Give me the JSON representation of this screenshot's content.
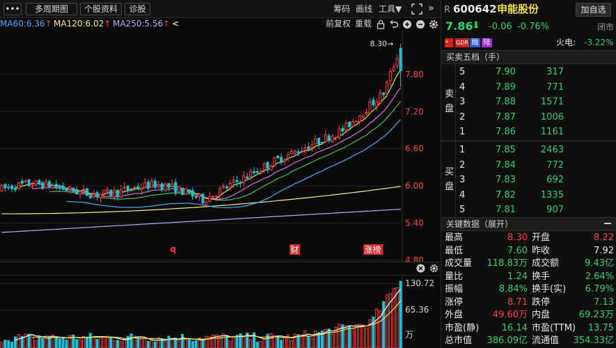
{
  "toolbar": {
    "menu_label": "•••",
    "multi_period": "多周期图",
    "stock_info": "个股资料",
    "diagnose": "诊股",
    "chips": "筹码",
    "draw": "画线",
    "tools": "工具▼"
  },
  "ma_row": {
    "ma60": "MA60:6.36",
    "ma120": "MA120:6.02",
    "ma250": "MA250:5.56",
    "arrow": "↑",
    "back": "<",
    "fq": "前复权",
    "reset": "重载"
  },
  "colors": {
    "up": "#ff4040",
    "down": "#2fd36c",
    "ma5": "#ffffff",
    "ma10": "#f0e040",
    "ma20": "#e070e0",
    "ma30": "#40c060",
    "ma60": "#4aa8ff",
    "ma120": "#f6f08a",
    "ma250": "#b0b0ff"
  },
  "chart_data": {
    "type": "candlestick",
    "y_ticks": [
      "7.80",
      "7.20",
      "6.60",
      "6.00",
      "5.40",
      "4.80"
    ],
    "ylim": [
      4.8,
      8.45
    ],
    "high_marker": "8.30→",
    "event_tags": [
      {
        "label": "q",
        "x_index": 50
      },
      {
        "label": "财",
        "x_index": 86
      },
      {
        "label": "涨榜",
        "x_index": 109
      }
    ],
    "volume_ticks": [
      "130.72",
      "65.36",
      "万"
    ]
  },
  "quote": {
    "prefix": "R",
    "code": "600642",
    "name": "申能股份",
    "add_watch": "加自选",
    "price": "7.86",
    "price_arrow": "⬇",
    "change": "-0.06",
    "change_pct": "-0.76%",
    "status": "闭市",
    "tag_gdr": "GDR",
    "tag_rong": "融",
    "tag_lu": "陆",
    "sector": "火电:",
    "sector_pct": "-3.22%"
  },
  "order_book": {
    "title": "买卖五档（手）",
    "sell_label": [
      "卖",
      "盘"
    ],
    "buy_label": [
      "买",
      "盘"
    ],
    "asks": [
      {
        "level": "5",
        "price": "7.90",
        "vol": "317"
      },
      {
        "level": "4",
        "price": "7.89",
        "vol": "771"
      },
      {
        "level": "3",
        "price": "7.88",
        "vol": "1571"
      },
      {
        "level": "2",
        "price": "7.87",
        "vol": "1006"
      },
      {
        "level": "1",
        "price": "7.86",
        "vol": "1161"
      }
    ],
    "bids": [
      {
        "level": "1",
        "price": "7.85",
        "vol": "2463"
      },
      {
        "level": "2",
        "price": "7.84",
        "vol": "772"
      },
      {
        "level": "3",
        "price": "7.83",
        "vol": "692"
      },
      {
        "level": "4",
        "price": "7.82",
        "vol": "1335"
      },
      {
        "level": "5",
        "price": "7.81",
        "vol": "907"
      }
    ]
  },
  "key_data": {
    "title": "关键数据（展开）",
    "rows": [
      {
        "l1": "最高",
        "v1": "8.30",
        "c1": "red",
        "l2": "开盘",
        "v2": "8.22",
        "c2": "red"
      },
      {
        "l1": "最低",
        "v1": "7.60",
        "c1": "green",
        "l2": "昨收",
        "v2": "7.92",
        "c2": "white"
      },
      {
        "l1": "成交量",
        "v1": "118.83万",
        "c1": "green",
        "l2": "成交额",
        "v2": "9.43亿",
        "c2": "green"
      },
      {
        "l1": "量比",
        "v1": "1.24",
        "c1": "green",
        "l2": "换手",
        "v2": "2.64%",
        "c2": "green"
      },
      {
        "l1": "振幅",
        "v1": "8.84%",
        "c1": "green",
        "l2": "换手(实)",
        "v2": "6.79%",
        "c2": "green"
      },
      {
        "l1": "涨停",
        "v1": "8.71",
        "c1": "red",
        "l2": "跌停",
        "v2": "7.13",
        "c2": "green"
      },
      {
        "l1": "外盘",
        "v1": "49.60万",
        "c1": "red",
        "l2": "内盘",
        "v2": "69.23万",
        "c2": "green"
      },
      {
        "l1": "市盈(静)",
        "v1": "16.14",
        "c1": "green",
        "l2": "市盈(TTM)",
        "v2": "13.75",
        "c2": "green"
      },
      {
        "l1": "总市值",
        "v1": "386.09亿",
        "c1": "green",
        "l2": "流通值",
        "v2": "354.33亿",
        "c2": "green"
      }
    ]
  }
}
